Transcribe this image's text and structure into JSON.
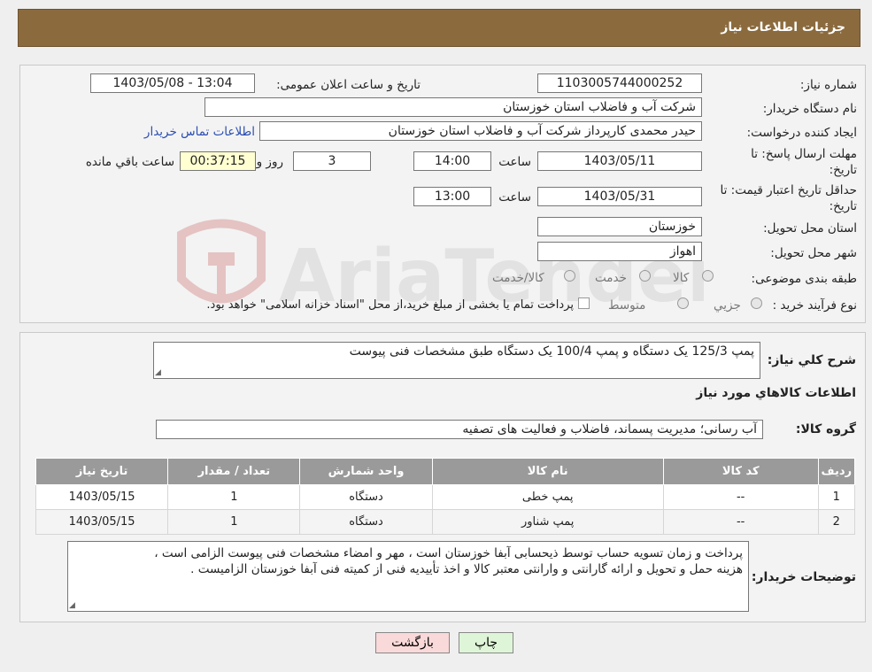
{
  "header": {
    "title": "جزئیات اطلاعات نیاز"
  },
  "form": {
    "need_number": {
      "label": "شماره نیاز:",
      "value": "1103005744000252"
    },
    "announce_datetime": {
      "label": "تاریخ و ساعت اعلان عمومی:",
      "value": "1403/05/08 - 13:04"
    },
    "buyer_org": {
      "label": "نام دستگاه خریدار:",
      "value": "شرکت آب و فاضلاب استان خوزستان"
    },
    "requester": {
      "label": "ایجاد کننده درخواست:",
      "value": "حیدر محمدی کارپرداز شرکت آب و فاضلاب استان خوزستان",
      "contact_link": "اطلاعات تماس خریدار"
    },
    "deadline": {
      "label_line1": "مهلت ارسال پاسخ: تا",
      "label_line2": "تاریخ:",
      "date": "1403/05/11",
      "time_label": "ساعت",
      "time": "14:00",
      "days": "3",
      "days_label": "روز و",
      "remaining": "00:37:15",
      "remaining_label": "ساعت باقي مانده"
    },
    "price_validity": {
      "label_line1": "حداقل تاریخ اعتبار قیمت: تا",
      "label_line2": "تاریخ:",
      "date": "1403/05/31",
      "time_label": "ساعت",
      "time": "13:00"
    },
    "delivery_province": {
      "label": "استان محل تحویل:",
      "value": "خوزستان"
    },
    "delivery_city": {
      "label": "شهر محل تحویل:",
      "value": "اهواز"
    },
    "category": {
      "label": "طبقه بندی موضوعی:",
      "options": [
        "کالا",
        "خدمت",
        "کالا/خدمت"
      ]
    },
    "purchase_type": {
      "label": "نوع فرآیند خرید :",
      "options": [
        "جزیي",
        "متوسط"
      ],
      "note": "پرداخت تمام یا بخشی از مبلغ خرید،از محل \"اسناد خزانه اسلامی\" خواهد بود."
    }
  },
  "summary": {
    "label": "شرح کلي نياز:",
    "value": "پمپ 125/3 یک دستگاه و پمپ 100/4 یک دستگاه طبق مشخصات فنی پیوست"
  },
  "goods_section": {
    "title": "اطلاعات کالاهاي مورد نياز",
    "group_label": "گروه کالا:",
    "group_value": "آب رسانی؛ مدیریت پسماند، فاضلاب و فعالیت های تصفیه"
  },
  "table": {
    "headers": [
      "رديف",
      "کد کالا",
      "نام کالا",
      "واحد شمارش",
      "تعداد / مقدار",
      "تاریخ نیاز"
    ],
    "rows": [
      [
        "1",
        "--",
        "پمپ خطی",
        "دستگاه",
        "1",
        "1403/05/15"
      ],
      [
        "2",
        "--",
        "پمپ شناور",
        "دستگاه",
        "1",
        "1403/05/15"
      ]
    ]
  },
  "buyer_notes": {
    "label": "توضیحات خریدار:",
    "line1": "پرداخت و زمان تسویه حساب توسط ذیحسابی آبفا خوزستان است ، مهر و امضاء مشخصات فنی پیوست الزامی است ،",
    "line2": "هزینه حمل و تحویل و ارائه گارانتی و وارانتی معتبر کالا و اخذ تأییدیه فنی از کمیته فنی آبفا خوزستان الزامیست ."
  },
  "buttons": {
    "print": "چاپ",
    "back": "بازگشت"
  },
  "watermark": {
    "text": "AriaTender.neT"
  },
  "colors": {
    "header": "#8b6b3e",
    "link": "#2a4db3",
    "back_button": "#f9d9d9",
    "print_button": "#dff5d8"
  }
}
